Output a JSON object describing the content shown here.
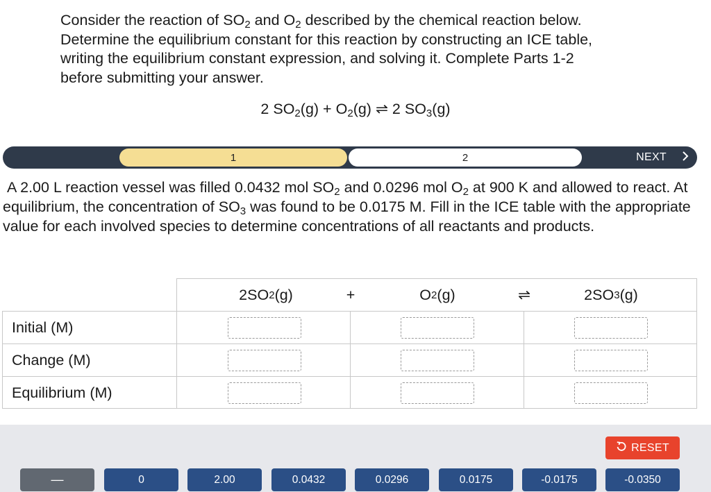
{
  "intro": {
    "line1_a": "Consider the reaction of SO",
    "line1_sub1": "2",
    "line1_b": " and O",
    "line1_sub2": "2",
    "line1_c": " described by the chemical reaction below.",
    "line2": "Determine the equilibrium constant for this reaction by constructing an ICE table,",
    "line3": "writing the equilibrium constant expression, and solving it.  Complete Parts 1-2",
    "line4": "before submitting your answer."
  },
  "equation": {
    "a": "2 SO",
    "a_sub": "2",
    "b": "(g) + O",
    "b_sub": "2",
    "c": "(g) ⇌ 2 SO",
    "c_sub": "3",
    "d": "(g)"
  },
  "stepbar": {
    "step1": "1",
    "step2": "2",
    "next_label": "NEXT",
    "next_icon": "chevron-right-icon"
  },
  "question": {
    "t1": "A 2.00 L reaction vessel was filled 0.0432 mol SO",
    "s1": "2",
    "t2": " and 0.0296 mol O",
    "s2": "2",
    "t3": " at 900 K and allowed to react. At equilibrium, the concentration of SO",
    "s3": "3",
    "t4": " was found to be 0.0175 M. Fill in the ICE table with the appropriate value for each involved species to determine concentrations of all reactants and products."
  },
  "ice": {
    "species1": "2SO",
    "species1_sub": "2",
    "species1_tail": "(g)",
    "plus": "+",
    "species2": "O",
    "species2_sub": "2",
    "species2_tail": "(g)",
    "arrow": "⇌",
    "species3": "2SO",
    "species3_sub": "3",
    "species3_tail": "(g)",
    "rows": [
      "Initial (M)",
      "Change (M)",
      "Equilibrium (M)"
    ]
  },
  "tray": {
    "reset_label": "RESET",
    "reset_icon": "undo-icon",
    "tiles": [
      "—",
      "0",
      "2.00",
      "0.0432",
      "0.0296",
      "0.0175",
      "-0.0175",
      "-0.0350"
    ]
  },
  "colors": {
    "stepbar": "#2f3a4a",
    "active_step": "#f5de94",
    "tile": "#2b4f86",
    "tile_blank": "#616871",
    "reset": "#e8432c",
    "tray": "#e7e8ec"
  }
}
